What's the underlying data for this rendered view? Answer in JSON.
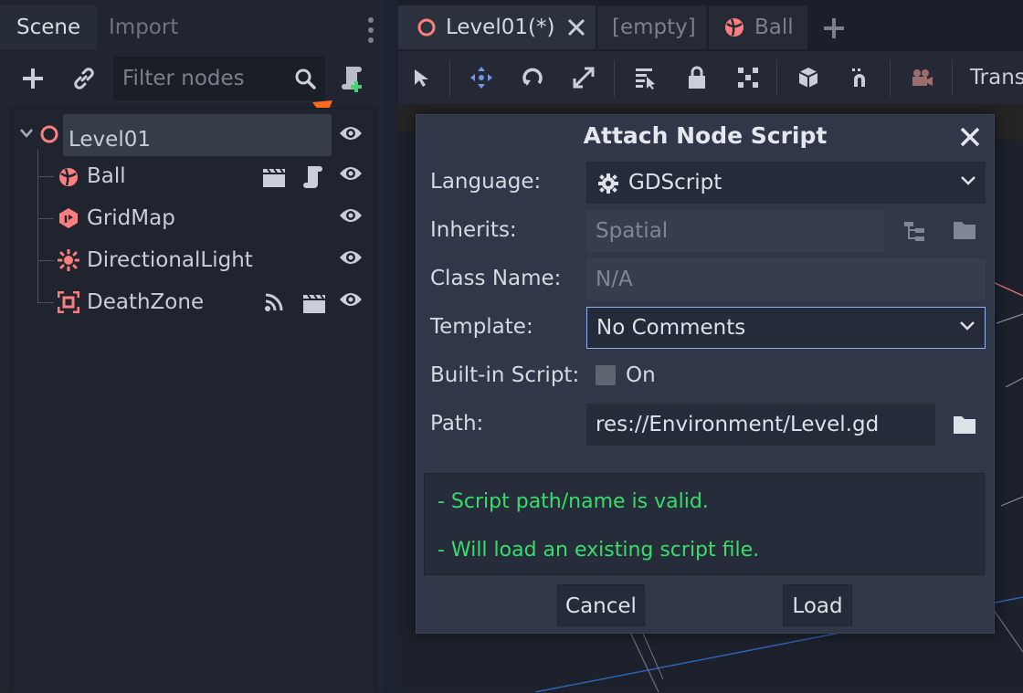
{
  "scene_dock": {
    "tabs": [
      {
        "label": "Scene",
        "active": true
      },
      {
        "label": "Import",
        "active": false
      }
    ],
    "filter": {
      "placeholder": "Filter nodes",
      "value": ""
    },
    "tree": [
      {
        "name": "Level01",
        "icon": "spatial-ring-icon",
        "color": "#fc7f7f",
        "selected": true,
        "badges": []
      },
      {
        "name": "Ball",
        "icon": "rigidbody-ball-icon",
        "color": "#fc7f7f",
        "badges": [
          "instance-clapper-icon",
          "script-scroll-icon"
        ]
      },
      {
        "name": "GridMap",
        "icon": "gridmap-icon",
        "color": "#fc7f7f",
        "badges": []
      },
      {
        "name": "DirectionalLight",
        "icon": "light-sun-icon",
        "color": "#fc7f7f",
        "badges": []
      },
      {
        "name": "DeathZone",
        "icon": "area-icon",
        "color": "#fc7f7f",
        "badges": [
          "signal-icon",
          "instance-clapper-icon"
        ]
      }
    ]
  },
  "editor": {
    "scene_tabs": [
      {
        "label": "Level01(*)",
        "active": true,
        "icon": "spatial-ring-icon"
      },
      {
        "label": "[empty]",
        "active": false
      },
      {
        "label": "Ball",
        "active": false,
        "icon": "rigidbody-ball-icon"
      }
    ],
    "toolbar_trailing_label": "Trans"
  },
  "dialog": {
    "title": "Attach Node Script",
    "language_label": "Language:",
    "language_value": "GDScript",
    "inherits_label": "Inherits:",
    "inherits_value": "Spatial",
    "class_name_label": "Class Name:",
    "class_name_value": "N/A",
    "template_label": "Template:",
    "template_value": "No Comments",
    "builtin_label": "Built-in Script:",
    "builtin_toggle_label": "On",
    "builtin_checked": false,
    "path_label": "Path:",
    "path_value": "res://Environment/Level.gd",
    "messages": [
      "- Script path/name is valid.",
      "- Will load an existing script file."
    ],
    "cancel_label": "Cancel",
    "load_label": "Load"
  },
  "colors": {
    "accent_node": "#fc7f7f",
    "valid_message": "#36dd6b",
    "highlight_arrow": "#ff6a1f",
    "add_script_plus": "#45d17a"
  }
}
